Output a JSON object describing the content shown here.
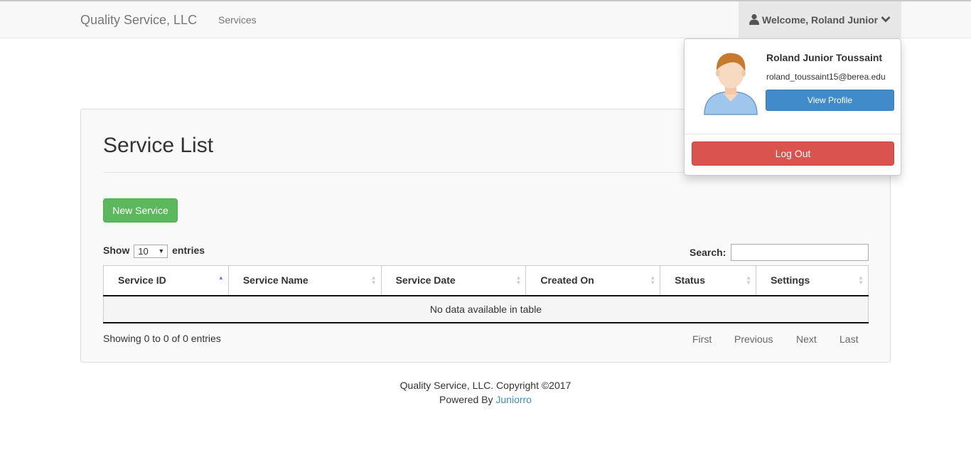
{
  "navbar": {
    "brand": "Quality Service, LLC",
    "nav_services": "Services",
    "welcome": "Welcome, Roland Junior"
  },
  "panel": {
    "title": "Service List",
    "new_button": "New Service",
    "show_label": "Show",
    "entries_value": "10",
    "entries_label": "entries",
    "search_label": "Search:",
    "search_value": ""
  },
  "table": {
    "columns": [
      "Service ID",
      "Service Name",
      "Service Date",
      "Created On",
      "Status",
      "Settings"
    ],
    "sorted_column": "Service ID",
    "sort_direction": "ascending",
    "empty_message": "No data available in table"
  },
  "pagination": {
    "info": "Showing 0 to 0 of 0 entries",
    "first": "First",
    "previous": "Previous",
    "next": "Next",
    "last": "Last"
  },
  "user_dropdown": {
    "name": "Roland Junior Toussaint",
    "email": "roland_toussaint15@berea.edu",
    "view_profile": "View Profile",
    "log_out": "Log Out"
  },
  "footer": {
    "copyright": "Quality Service, LLC. Copyright ©2017",
    "powered_by": "Powered By",
    "powered_link": "Juniorro"
  },
  "icons": {
    "user": "user-icon",
    "chevron": "chevron-down-icon",
    "avatar": "avatar-icon"
  },
  "colors": {
    "success": "#5cb85c",
    "primary": "#428bca",
    "danger": "#d9534f",
    "sort_active": "#6b77d8"
  }
}
